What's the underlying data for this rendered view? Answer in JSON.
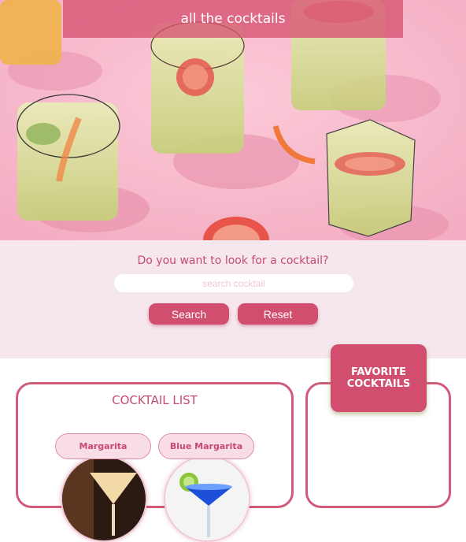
{
  "header": {
    "title": "all the cocktails"
  },
  "search": {
    "question": "Do you want to look for a cocktail?",
    "placeholder": "search cocktail",
    "search_label": "Search",
    "reset_label": "Reset"
  },
  "cocktail_list": {
    "title": "COCKTAIL LIST",
    "items": [
      {
        "name": "Margarita",
        "image": "margarita-photo"
      },
      {
        "name": "Blue Margarita",
        "image": "blue-margarita-photo"
      }
    ]
  },
  "favorites": {
    "title": "FAVORITE COCKTAILS"
  },
  "colors": {
    "accent": "#d24e6e",
    "hero_pink": "#f7b9cb",
    "panel": "#f6e7ee",
    "text_pink": "#c84a6e"
  }
}
